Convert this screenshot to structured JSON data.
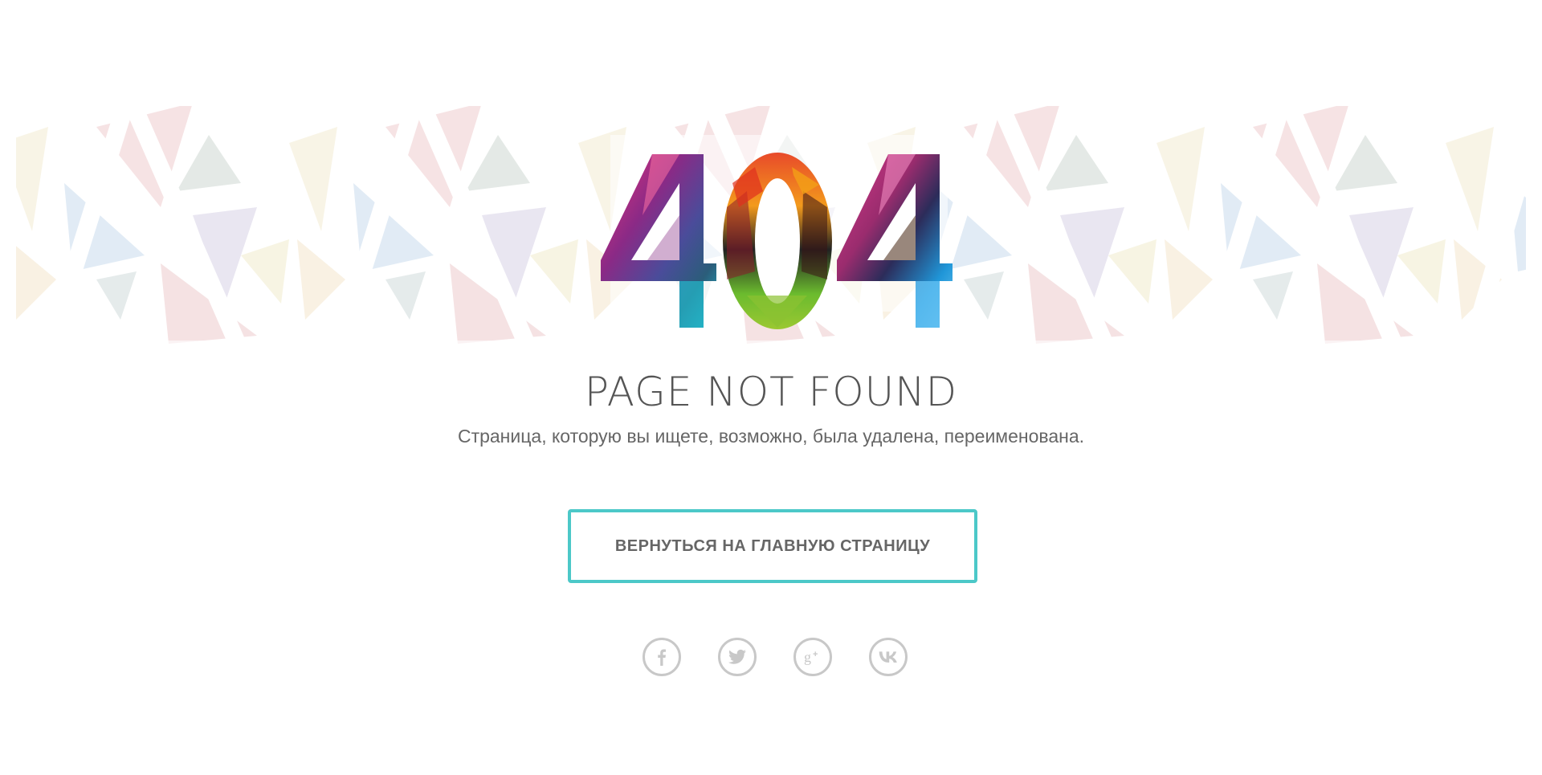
{
  "error_code": "404",
  "title": "PAGE NOT FOUND",
  "subtitle": "Страница, которую вы ищете, возможно, была удалена, переименована.",
  "home_button": {
    "label": "ВЕРНУТЬСЯ НА ГЛАВНУЮ СТРАНИЦУ"
  },
  "colors": {
    "accent": "#4cc8c8",
    "title_text": "#555555",
    "body_text": "#666666",
    "social_icon": "#c8c8c8"
  },
  "social_links": [
    {
      "icon": "facebook-icon"
    },
    {
      "icon": "twitter-icon"
    },
    {
      "icon": "google-plus-icon"
    },
    {
      "icon": "vk-icon"
    }
  ]
}
